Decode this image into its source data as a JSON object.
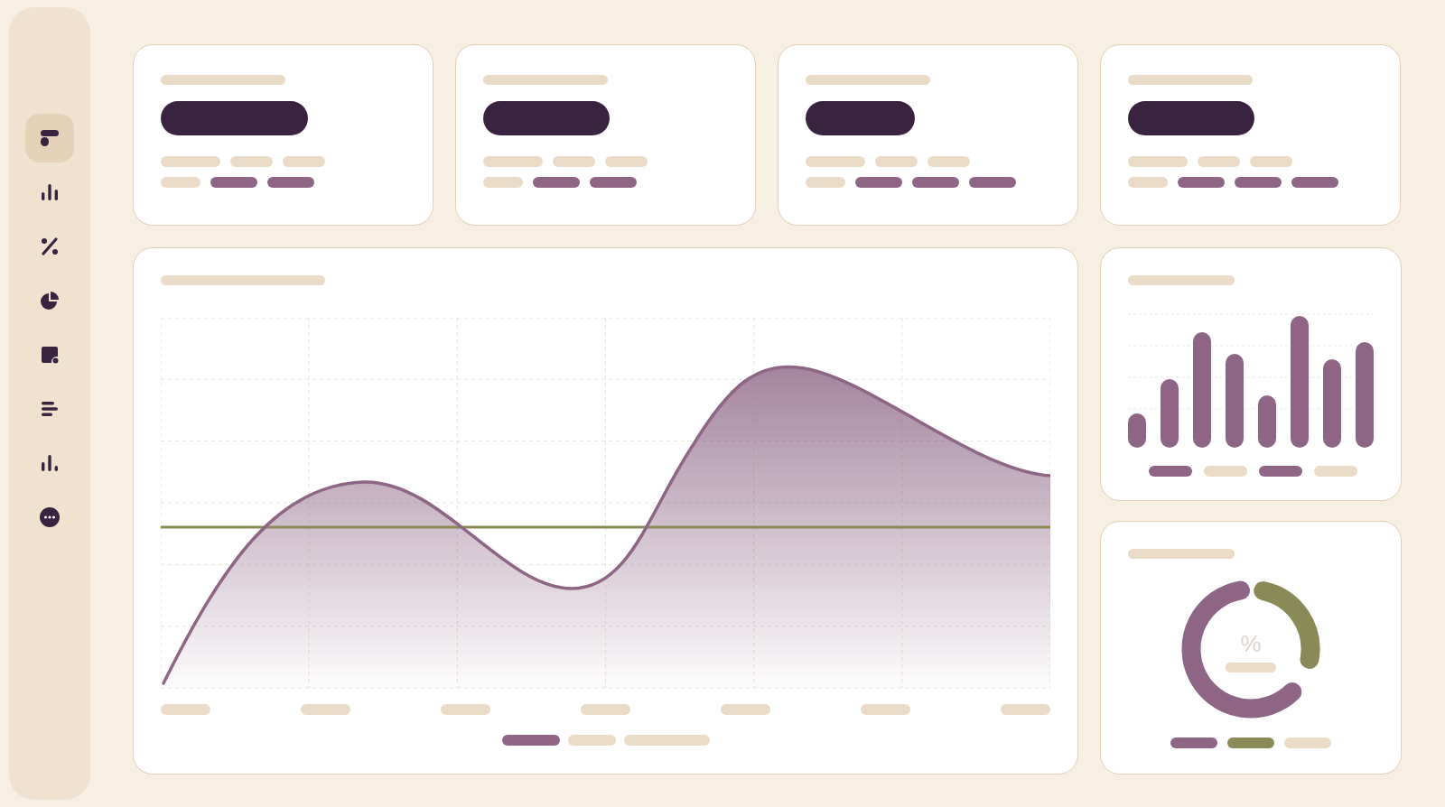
{
  "sidebar": {
    "items": [
      {
        "selected": true
      },
      {
        "selected": false
      },
      {
        "selected": false
      },
      {
        "selected": false
      },
      {
        "selected": false
      },
      {
        "selected": false
      },
      {
        "selected": false
      },
      {
        "selected": false
      }
    ]
  },
  "stat_cards": [
    {
      "rows": [
        [
          {
            "kind": "muted"
          },
          {
            "kind": "muted"
          },
          {
            "kind": "muted"
          }
        ],
        [
          {
            "kind": "muted"
          },
          {
            "kind": "accent"
          },
          {
            "kind": "accent"
          }
        ]
      ]
    },
    {
      "rows": [
        [
          {
            "kind": "muted"
          },
          {
            "kind": "muted"
          },
          {
            "kind": "muted"
          }
        ],
        [
          {
            "kind": "muted"
          },
          {
            "kind": "accent"
          },
          {
            "kind": "accent"
          }
        ]
      ]
    },
    {
      "rows": [
        [
          {
            "kind": "muted"
          },
          {
            "kind": "muted"
          },
          {
            "kind": "muted"
          }
        ],
        [
          {
            "kind": "muted"
          },
          {
            "kind": "accent"
          },
          {
            "kind": "accent"
          },
          {
            "kind": "accent"
          }
        ]
      ]
    },
    {
      "rows": [
        [
          {
            "kind": "muted"
          },
          {
            "kind": "muted"
          },
          {
            "kind": "muted"
          }
        ],
        [
          {
            "kind": "muted"
          },
          {
            "kind": "accent"
          },
          {
            "kind": "accent"
          },
          {
            "kind": "accent"
          }
        ]
      ]
    }
  ],
  "area_chart": {
    "kind": "picture",
    "legend": [
      {
        "color": "#8e6585"
      },
      {
        "color": "#eadbc6"
      },
      {
        "color": "#eadbc6"
      }
    ]
  },
  "bar_chart": {
    "kind": "picture",
    "legend": [
      {
        "color": "#8e6585"
      },
      {
        "color": "#eadbc6"
      },
      {
        "color": "#8e6585"
      },
      {
        "color": "#eadbc6"
      }
    ]
  },
  "donut_chart": {
    "center": "%",
    "legend": [
      {
        "color": "#8e6585"
      },
      {
        "color": "#8a8a58"
      },
      {
        "color": "#eadbc6"
      }
    ]
  }
}
